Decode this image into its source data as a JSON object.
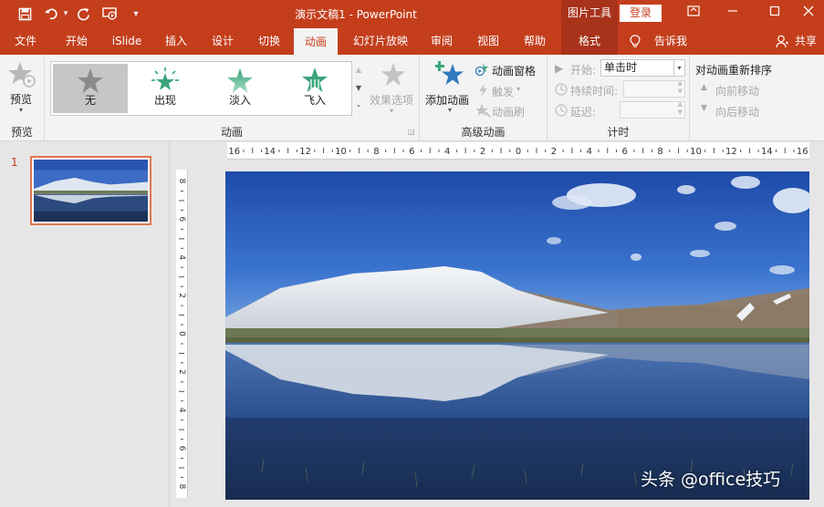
{
  "titlebar": {
    "title": "演示文稿1  -  PowerPoint",
    "context_title": "图片工具",
    "login": "登录",
    "qat_more": "▾"
  },
  "tabs": [
    {
      "label": "文件"
    },
    {
      "label": "开始"
    },
    {
      "label": "iSlide"
    },
    {
      "label": "插入"
    },
    {
      "label": "设计"
    },
    {
      "label": "切换"
    },
    {
      "label": "动画"
    },
    {
      "label": "幻灯片放映"
    },
    {
      "label": "审阅"
    },
    {
      "label": "视图"
    },
    {
      "label": "帮助"
    },
    {
      "label": "格式"
    }
  ],
  "tell_me": "告诉我",
  "share": "共享",
  "ribbon": {
    "preview": {
      "button": "预览",
      "group": "预览"
    },
    "animation": {
      "gallery": [
        "无",
        "出现",
        "淡入",
        "飞入"
      ],
      "effect_options": "效果选项",
      "group": "动画"
    },
    "advanced": {
      "add_animation": "添加动画",
      "animation_pane": "动画窗格",
      "trigger": "触发",
      "painter": "动画刷",
      "group": "高级动画"
    },
    "timing": {
      "start_label": "开始:",
      "start_value": "单击时",
      "duration_label": "持续时间:",
      "delay_label": "延迟:",
      "group": "计时"
    },
    "reorder": {
      "title": "对动画重新排序",
      "forward": "向前移动",
      "backward": "向后移动"
    }
  },
  "slides_pane": {
    "slide_number": "1"
  },
  "ruler": {
    "h_labels": [
      "16",
      "14",
      "12",
      "10",
      "8",
      "6",
      "4",
      "2",
      "0",
      "2",
      "4",
      "6",
      "8",
      "10",
      "12",
      "14",
      "16"
    ],
    "v_labels": [
      "8",
      "6",
      "4",
      "2",
      "0",
      "2",
      "4",
      "6",
      "8"
    ]
  },
  "watermark": "头条 @office技巧",
  "colors": {
    "accent": "#c43e1c",
    "context_tab": "#a8321a",
    "ribbon_bg": "#f3f3f3",
    "star_green": "#3aa57b"
  }
}
